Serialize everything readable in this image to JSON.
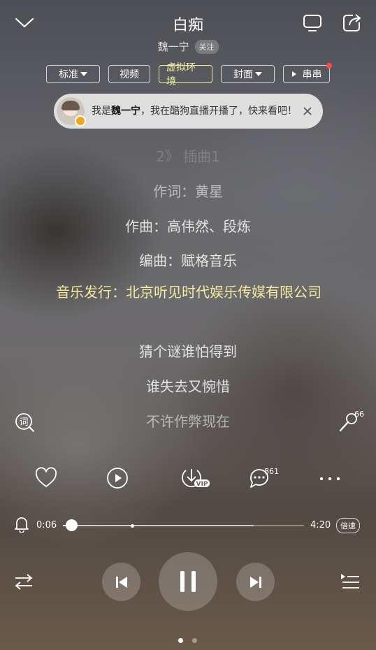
{
  "header": {
    "song_title": "白痴",
    "artist": "魏一宁",
    "follow_label": "关注"
  },
  "chips": [
    {
      "label": "标准",
      "has_dropdown": true,
      "active": false
    },
    {
      "label": "视频",
      "has_dropdown": false,
      "active": false
    },
    {
      "label": "虚拟环境",
      "has_dropdown": false,
      "active": true
    },
    {
      "label": "封面",
      "has_dropdown": true,
      "active": false
    },
    {
      "label": "串串",
      "has_dropdown": false,
      "active": false,
      "icon": "play-small-icon",
      "notification_dot": true
    }
  ],
  "notification": {
    "prefix": "我是",
    "name": "魏一宁",
    "suffix": "，我在酷狗直播开播了，快来看吧！"
  },
  "lyrics": {
    "faded_line": "2》 插曲1",
    "lines": [
      "作词：黄星",
      "作曲：高伟然、段炼",
      "编曲：赋格音乐"
    ],
    "current_line": "音乐发行：北京听见时代娱乐传媒有限公司",
    "upcoming": [
      "猜个谜谁怕得到",
      "谁失去又惋惜",
      "不许作弊现在"
    ]
  },
  "side": {
    "lyrics_label": "词",
    "mic_count": "66"
  },
  "actions": {
    "comment_count": "861",
    "vip_label": "VIP"
  },
  "progress": {
    "elapsed": "0:06",
    "total": "4:20",
    "played_fraction": 0.023,
    "buffered_fraction": 0.79,
    "speed_label": "倍速"
  },
  "colors": {
    "accent_yellow": "#f4eaa0",
    "notification_dot": "#ff4b4b"
  },
  "icons": [
    "chevron-down-icon",
    "cast-screen-icon",
    "share-icon",
    "lyrics-search-icon",
    "microphone-icon",
    "heart-icon",
    "play-video-icon",
    "download-vip-icon",
    "comment-icon",
    "more-icon",
    "bell-icon",
    "shuffle-icon",
    "previous-icon",
    "pause-icon",
    "next-icon",
    "playlist-icon"
  ],
  "pager": {
    "current": 1,
    "total": 2
  }
}
